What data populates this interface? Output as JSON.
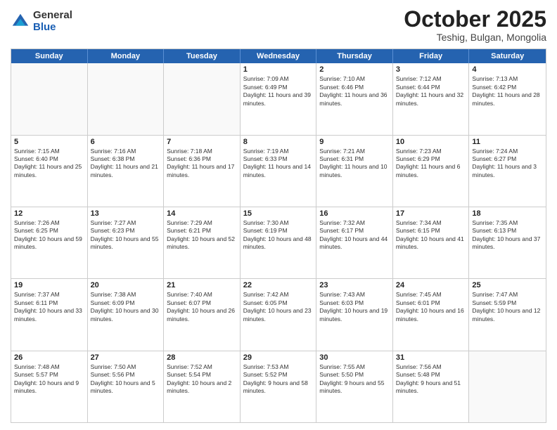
{
  "header": {
    "logo": {
      "general": "General",
      "blue": "Blue"
    },
    "title": "October 2025",
    "location": "Teshig, Bulgan, Mongolia"
  },
  "days_of_week": [
    "Sunday",
    "Monday",
    "Tuesday",
    "Wednesday",
    "Thursday",
    "Friday",
    "Saturday"
  ],
  "weeks": [
    [
      {
        "day": "",
        "empty": true
      },
      {
        "day": "",
        "empty": true
      },
      {
        "day": "",
        "empty": true
      },
      {
        "day": "1",
        "sunrise": "Sunrise: 7:09 AM",
        "sunset": "Sunset: 6:49 PM",
        "daylight": "Daylight: 11 hours and 39 minutes."
      },
      {
        "day": "2",
        "sunrise": "Sunrise: 7:10 AM",
        "sunset": "Sunset: 6:46 PM",
        "daylight": "Daylight: 11 hours and 36 minutes."
      },
      {
        "day": "3",
        "sunrise": "Sunrise: 7:12 AM",
        "sunset": "Sunset: 6:44 PM",
        "daylight": "Daylight: 11 hours and 32 minutes."
      },
      {
        "day": "4",
        "sunrise": "Sunrise: 7:13 AM",
        "sunset": "Sunset: 6:42 PM",
        "daylight": "Daylight: 11 hours and 28 minutes."
      }
    ],
    [
      {
        "day": "5",
        "sunrise": "Sunrise: 7:15 AM",
        "sunset": "Sunset: 6:40 PM",
        "daylight": "Daylight: 11 hours and 25 minutes."
      },
      {
        "day": "6",
        "sunrise": "Sunrise: 7:16 AM",
        "sunset": "Sunset: 6:38 PM",
        "daylight": "Daylight: 11 hours and 21 minutes."
      },
      {
        "day": "7",
        "sunrise": "Sunrise: 7:18 AM",
        "sunset": "Sunset: 6:36 PM",
        "daylight": "Daylight: 11 hours and 17 minutes."
      },
      {
        "day": "8",
        "sunrise": "Sunrise: 7:19 AM",
        "sunset": "Sunset: 6:33 PM",
        "daylight": "Daylight: 11 hours and 14 minutes."
      },
      {
        "day": "9",
        "sunrise": "Sunrise: 7:21 AM",
        "sunset": "Sunset: 6:31 PM",
        "daylight": "Daylight: 11 hours and 10 minutes."
      },
      {
        "day": "10",
        "sunrise": "Sunrise: 7:23 AM",
        "sunset": "Sunset: 6:29 PM",
        "daylight": "Daylight: 11 hours and 6 minutes."
      },
      {
        "day": "11",
        "sunrise": "Sunrise: 7:24 AM",
        "sunset": "Sunset: 6:27 PM",
        "daylight": "Daylight: 11 hours and 3 minutes."
      }
    ],
    [
      {
        "day": "12",
        "sunrise": "Sunrise: 7:26 AM",
        "sunset": "Sunset: 6:25 PM",
        "daylight": "Daylight: 10 hours and 59 minutes."
      },
      {
        "day": "13",
        "sunrise": "Sunrise: 7:27 AM",
        "sunset": "Sunset: 6:23 PM",
        "daylight": "Daylight: 10 hours and 55 minutes."
      },
      {
        "day": "14",
        "sunrise": "Sunrise: 7:29 AM",
        "sunset": "Sunset: 6:21 PM",
        "daylight": "Daylight: 10 hours and 52 minutes."
      },
      {
        "day": "15",
        "sunrise": "Sunrise: 7:30 AM",
        "sunset": "Sunset: 6:19 PM",
        "daylight": "Daylight: 10 hours and 48 minutes."
      },
      {
        "day": "16",
        "sunrise": "Sunrise: 7:32 AM",
        "sunset": "Sunset: 6:17 PM",
        "daylight": "Daylight: 10 hours and 44 minutes."
      },
      {
        "day": "17",
        "sunrise": "Sunrise: 7:34 AM",
        "sunset": "Sunset: 6:15 PM",
        "daylight": "Daylight: 10 hours and 41 minutes."
      },
      {
        "day": "18",
        "sunrise": "Sunrise: 7:35 AM",
        "sunset": "Sunset: 6:13 PM",
        "daylight": "Daylight: 10 hours and 37 minutes."
      }
    ],
    [
      {
        "day": "19",
        "sunrise": "Sunrise: 7:37 AM",
        "sunset": "Sunset: 6:11 PM",
        "daylight": "Daylight: 10 hours and 33 minutes."
      },
      {
        "day": "20",
        "sunrise": "Sunrise: 7:38 AM",
        "sunset": "Sunset: 6:09 PM",
        "daylight": "Daylight: 10 hours and 30 minutes."
      },
      {
        "day": "21",
        "sunrise": "Sunrise: 7:40 AM",
        "sunset": "Sunset: 6:07 PM",
        "daylight": "Daylight: 10 hours and 26 minutes."
      },
      {
        "day": "22",
        "sunrise": "Sunrise: 7:42 AM",
        "sunset": "Sunset: 6:05 PM",
        "daylight": "Daylight: 10 hours and 23 minutes."
      },
      {
        "day": "23",
        "sunrise": "Sunrise: 7:43 AM",
        "sunset": "Sunset: 6:03 PM",
        "daylight": "Daylight: 10 hours and 19 minutes."
      },
      {
        "day": "24",
        "sunrise": "Sunrise: 7:45 AM",
        "sunset": "Sunset: 6:01 PM",
        "daylight": "Daylight: 10 hours and 16 minutes."
      },
      {
        "day": "25",
        "sunrise": "Sunrise: 7:47 AM",
        "sunset": "Sunset: 5:59 PM",
        "daylight": "Daylight: 10 hours and 12 minutes."
      }
    ],
    [
      {
        "day": "26",
        "sunrise": "Sunrise: 7:48 AM",
        "sunset": "Sunset: 5:57 PM",
        "daylight": "Daylight: 10 hours and 9 minutes."
      },
      {
        "day": "27",
        "sunrise": "Sunrise: 7:50 AM",
        "sunset": "Sunset: 5:56 PM",
        "daylight": "Daylight: 10 hours and 5 minutes."
      },
      {
        "day": "28",
        "sunrise": "Sunrise: 7:52 AM",
        "sunset": "Sunset: 5:54 PM",
        "daylight": "Daylight: 10 hours and 2 minutes."
      },
      {
        "day": "29",
        "sunrise": "Sunrise: 7:53 AM",
        "sunset": "Sunset: 5:52 PM",
        "daylight": "Daylight: 9 hours and 58 minutes."
      },
      {
        "day": "30",
        "sunrise": "Sunrise: 7:55 AM",
        "sunset": "Sunset: 5:50 PM",
        "daylight": "Daylight: 9 hours and 55 minutes."
      },
      {
        "day": "31",
        "sunrise": "Sunrise: 7:56 AM",
        "sunset": "Sunset: 5:48 PM",
        "daylight": "Daylight: 9 hours and 51 minutes."
      },
      {
        "day": "",
        "empty": true
      }
    ]
  ]
}
